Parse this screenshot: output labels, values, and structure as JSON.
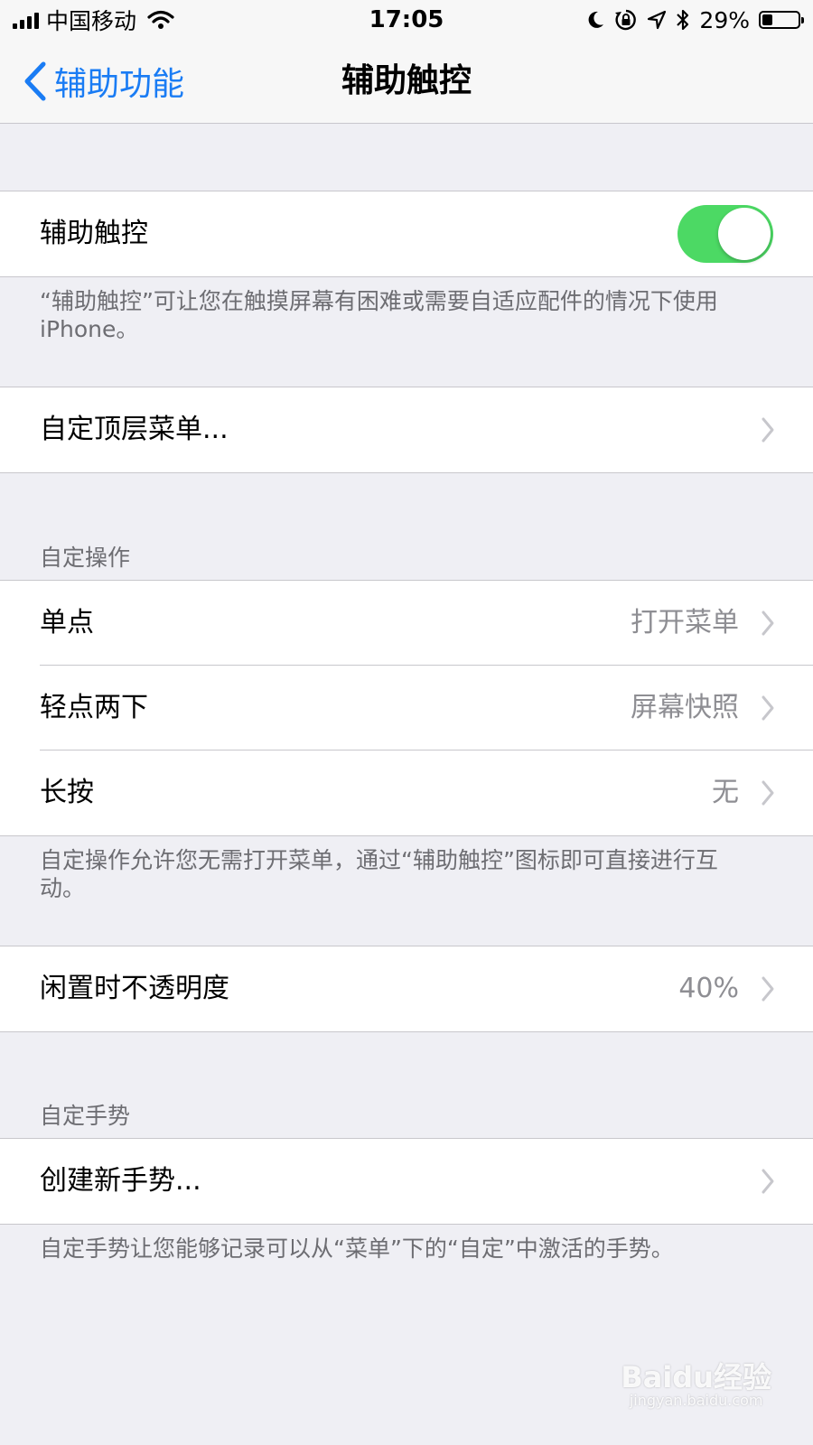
{
  "status_bar": {
    "carrier": "中国移动",
    "time": "17:05",
    "battery_percent": "29%",
    "battery_level": 0.29
  },
  "nav": {
    "back_label": "辅助功能",
    "title": "辅助触控"
  },
  "assistive_touch": {
    "label": "辅助触控",
    "enabled": true,
    "footer": "“辅助触控”可让您在触摸屏幕有困难或需要自适应配件的情况下使用 iPhone。"
  },
  "customize_menu": {
    "label": "自定顶层菜单..."
  },
  "custom_actions": {
    "header": "自定操作",
    "rows": [
      {
        "label": "单点",
        "value": "打开菜单"
      },
      {
        "label": "轻点两下",
        "value": "屏幕快照"
      },
      {
        "label": "长按",
        "value": "无"
      }
    ],
    "footer": "自定操作允许您无需打开菜单，通过“辅助触控”图标即可直接进行互动。"
  },
  "idle_opacity": {
    "label": "闲置时不透明度",
    "value": "40%"
  },
  "custom_gestures": {
    "header": "自定手势",
    "create_label": "创建新手势...",
    "footer": "自定手势让您能够记录可以从“菜单”下的“自定”中激活的手势。"
  },
  "watermark": {
    "logo": "Baidu经验",
    "url": "jingyan.baidu.com"
  },
  "colors": {
    "accent": "#1a7cf4",
    "toggle_on": "#4cd964",
    "background": "#efeff4"
  },
  "icons": {
    "back": "chevron-left-icon",
    "disclosure": "chevron-right-icon",
    "wifi": "wifi-icon",
    "moon": "moon-icon",
    "rotation_lock": "rotation-lock-icon",
    "location": "location-arrow-icon",
    "bluetooth": "bluetooth-icon",
    "battery": "battery-icon"
  }
}
